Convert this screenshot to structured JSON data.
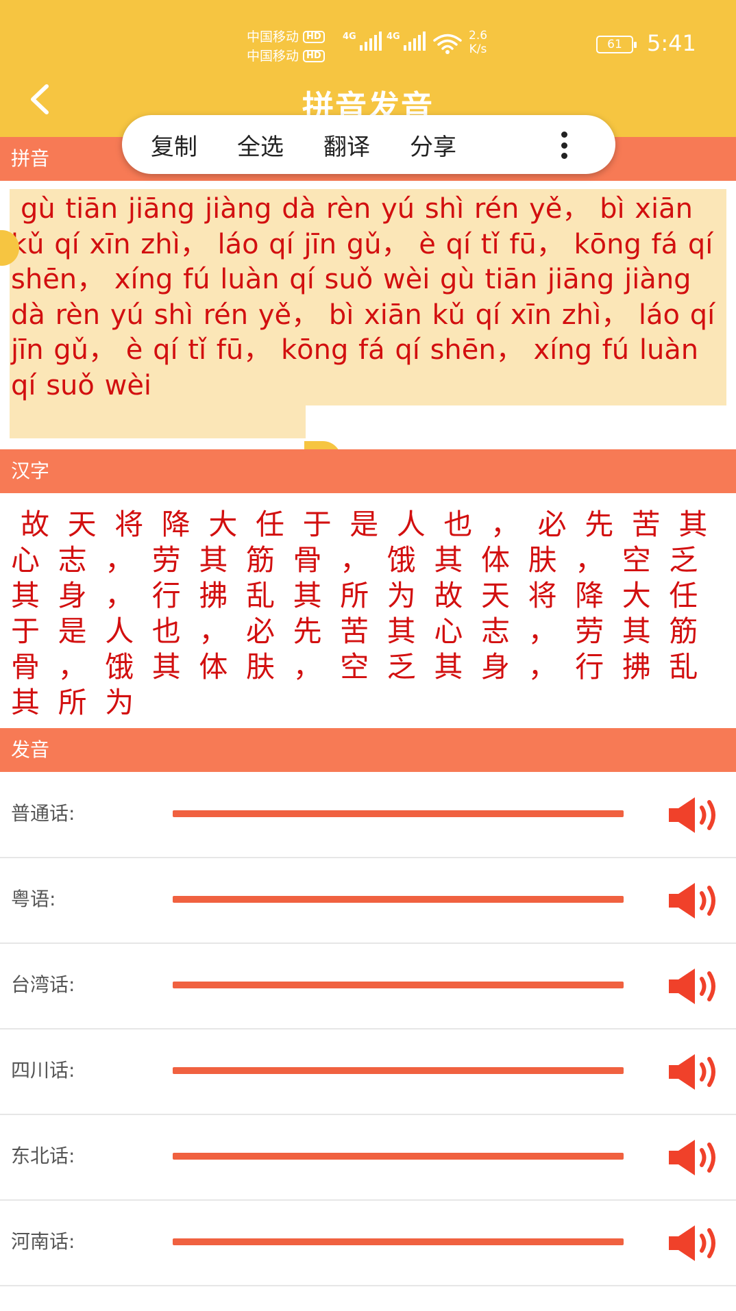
{
  "status_bar": {
    "carrier_1": "中国移动",
    "carrier_2": "中国移动",
    "hd_badge": "HD",
    "network_1": "4G",
    "network_2": "4G",
    "speed_value": "2.6",
    "speed_unit": "K/s",
    "battery_level": "61",
    "time": "5:41"
  },
  "header": {
    "back_icon": "chevron-left-icon",
    "title": "拼音发音"
  },
  "context_menu": {
    "items": [
      "复制",
      "全选",
      "翻译",
      "分享"
    ],
    "more_icon": "more-vertical-icon"
  },
  "sections": {
    "pinyin_label": "拼音",
    "hanzi_label": "汉字",
    "pronounce_label": "发音"
  },
  "pinyin_text": "gù tiān jiāng jiàng dà rèn yú shì rén yě， bì xiān kǔ qí xīn zhì， láo qí jīn gǔ， è qí tǐ fū， kōng fá qí shēn， xíng fú luàn qí suǒ wèi gù tiān jiāng jiàng dà rèn yú shì rén yě， bì xiān kǔ qí xīn zhì， láo qí jīn gǔ， è qí tǐ fū， kōng fá qí shēn， xíng fú luàn qí suǒ wèi",
  "hanzi_text": "故天将降大任于是人也，必先苦其心志，劳其筋骨，饿其体肤，空乏其身，行拂乱其所为故天将降大任于是人也，必先苦其心志，劳其筋骨，饿其体肤，空乏其身，行拂乱其所为",
  "dialects": [
    {
      "label": "普通话:",
      "icon": "speaker-icon"
    },
    {
      "label": "粤语:",
      "icon": "speaker-icon"
    },
    {
      "label": "台湾话:",
      "icon": "speaker-icon"
    },
    {
      "label": "四川话:",
      "icon": "speaker-icon"
    },
    {
      "label": "东北话:",
      "icon": "speaker-icon"
    },
    {
      "label": "河南话:",
      "icon": "speaker-icon"
    }
  ],
  "colors": {
    "header_bg": "#f6c541",
    "section_bg": "#f77a55",
    "text_red": "#d20f0f",
    "selection": "#fbe6b7",
    "accent": "#f06140"
  }
}
